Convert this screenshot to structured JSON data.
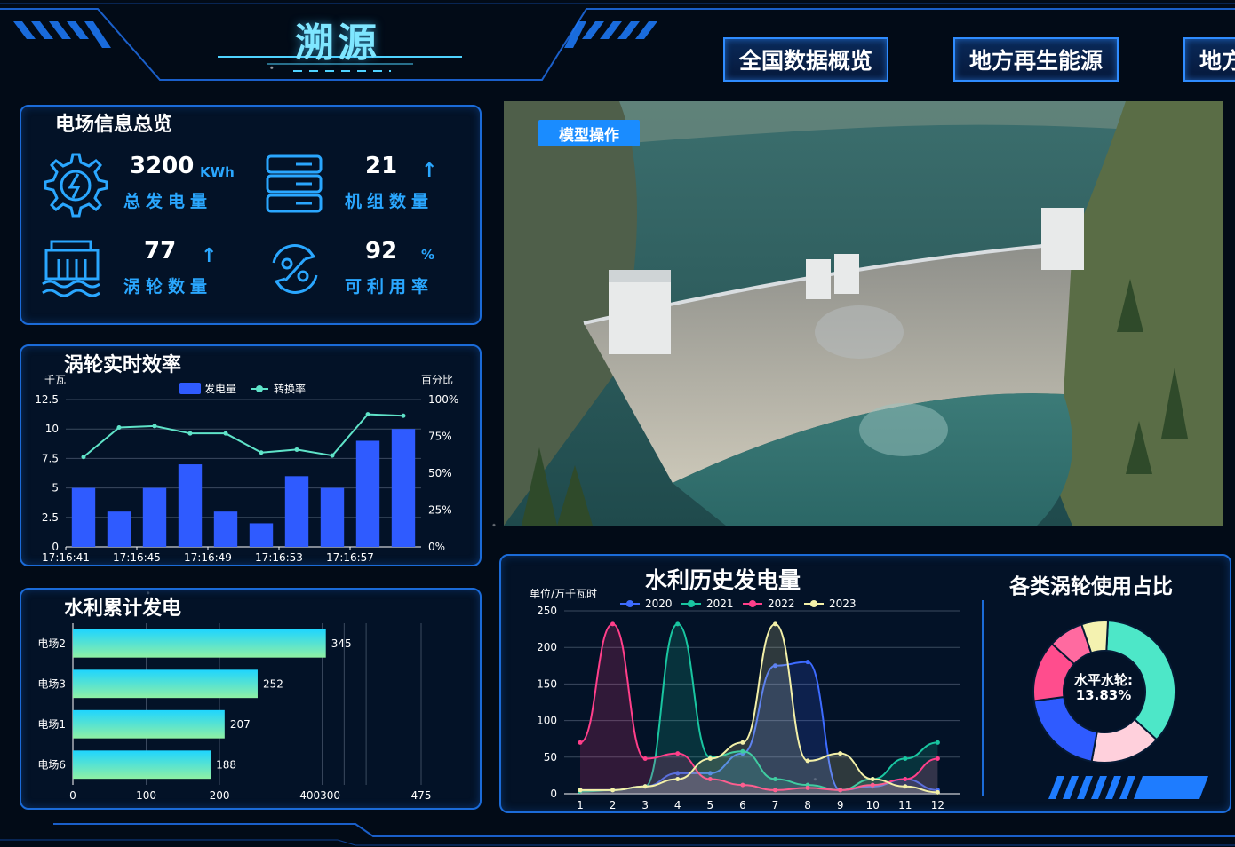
{
  "header": {
    "title": "溯源",
    "nav": [
      "全国数据概览",
      "地方再生能源",
      "地方"
    ]
  },
  "overview": {
    "title": "电场信息总览",
    "stats": [
      {
        "value": "3200",
        "unit": "KWh",
        "label": "总发电量",
        "icon": "gear-bolt-icon"
      },
      {
        "value": "21",
        "unit": "↑",
        "label": "机组数量",
        "icon": "server-icon"
      },
      {
        "value": "77",
        "unit": "↑",
        "label": "涡轮数量",
        "icon": "water-plant-icon"
      },
      {
        "value": "92",
        "unit": "%",
        "label": "可利用率",
        "icon": "percent-cycle-icon"
      }
    ]
  },
  "efficiency": {
    "title": "涡轮实时效率"
  },
  "cumulative": {
    "title": "水利累计发电"
  },
  "scene": {
    "model_button": "模型操作"
  },
  "history": {
    "title": "水利历史发电量",
    "unit": "单位/万千瓦时"
  },
  "share": {
    "title": "各类涡轮使用占比",
    "center_label": "水平水轮:",
    "center_value": "13.83%"
  },
  "colors": {
    "accent": "#1b6bd8",
    "bar": "#2f5bff",
    "line": "#5fe3c8"
  },
  "chart_data": [
    {
      "type": "bar",
      "title": "涡轮实时效率",
      "categories": [
        "17:16:41",
        "",
        "17:16:45",
        "",
        "17:16:49",
        "",
        "17:16:53",
        "",
        "17:16:57",
        ""
      ],
      "xticks": [
        "17:16:41",
        "17:16:45",
        "17:16:49",
        "17:16:53",
        "17:16:57"
      ],
      "ylabel": "千瓦",
      "y2label": "百分比",
      "yticks": [
        "0",
        "2.5",
        "5",
        "7.5",
        "10",
        "12.5"
      ],
      "y2ticks": [
        "0%",
        "25%",
        "50%",
        "75%",
        "100%"
      ],
      "ylim": [
        0,
        12.5
      ],
      "y2lim": [
        0,
        100
      ],
      "series": [
        {
          "name": "发电量",
          "kind": "bar",
          "values": [
            5,
            3,
            5,
            7,
            3,
            2,
            6,
            5,
            9,
            10
          ]
        },
        {
          "name": "转换率",
          "kind": "line",
          "axis": "right",
          "values": [
            61,
            81,
            82,
            77,
            77,
            64,
            66,
            62,
            90,
            89
          ]
        }
      ]
    },
    {
      "type": "bar",
      "orientation": "horizontal",
      "title": "水利累计发电",
      "categories": [
        "电场2",
        "电场3",
        "电场1",
        "电场6"
      ],
      "values": [
        345,
        252,
        207,
        188
      ],
      "xticks": [
        "0",
        "100",
        "200",
        "400300",
        "475"
      ],
      "xlim": [
        0,
        475
      ]
    },
    {
      "type": "area",
      "title": "水利历史发电量",
      "ylabel": "单位/万千瓦时",
      "x": [
        1,
        2,
        3,
        4,
        5,
        6,
        7,
        8,
        9,
        10,
        11,
        12
      ],
      "ylim": [
        0,
        250
      ],
      "yticks": [
        "0",
        "50",
        "100",
        "150",
        "200",
        "250"
      ],
      "series": [
        {
          "name": "2020",
          "color": "#3d6bff",
          "values": [
            5,
            5,
            10,
            28,
            28,
            55,
            175,
            180,
            5,
            10,
            20,
            5
          ]
        },
        {
          "name": "2021",
          "color": "#19c5a0",
          "values": [
            3,
            5,
            10,
            232,
            50,
            58,
            20,
            12,
            5,
            20,
            48,
            70
          ]
        },
        {
          "name": "2022",
          "color": "#ff3f8a",
          "values": [
            70,
            232,
            48,
            55,
            20,
            12,
            5,
            8,
            5,
            12,
            20,
            48
          ]
        },
        {
          "name": "2023",
          "color": "#f3f0a8",
          "values": [
            5,
            5,
            10,
            20,
            48,
            70,
            232,
            45,
            55,
            20,
            10,
            2
          ]
        }
      ]
    },
    {
      "type": "pie",
      "title": "各类涡轮使用占比",
      "slices": [
        {
          "label": "水平水轮",
          "value": 13.83,
          "color": "#ff4d8d"
        },
        {
          "label": "",
          "value": 36,
          "color": "#4de7c8"
        },
        {
          "label": "",
          "value": 16,
          "color": "#ffd0dc"
        },
        {
          "label": "",
          "value": 20,
          "color": "#2f5bff"
        },
        {
          "label": "",
          "value": 8,
          "color": "#ff6aa0"
        },
        {
          "label": "",
          "value": 6,
          "color": "#f4f2b0"
        }
      ]
    }
  ]
}
